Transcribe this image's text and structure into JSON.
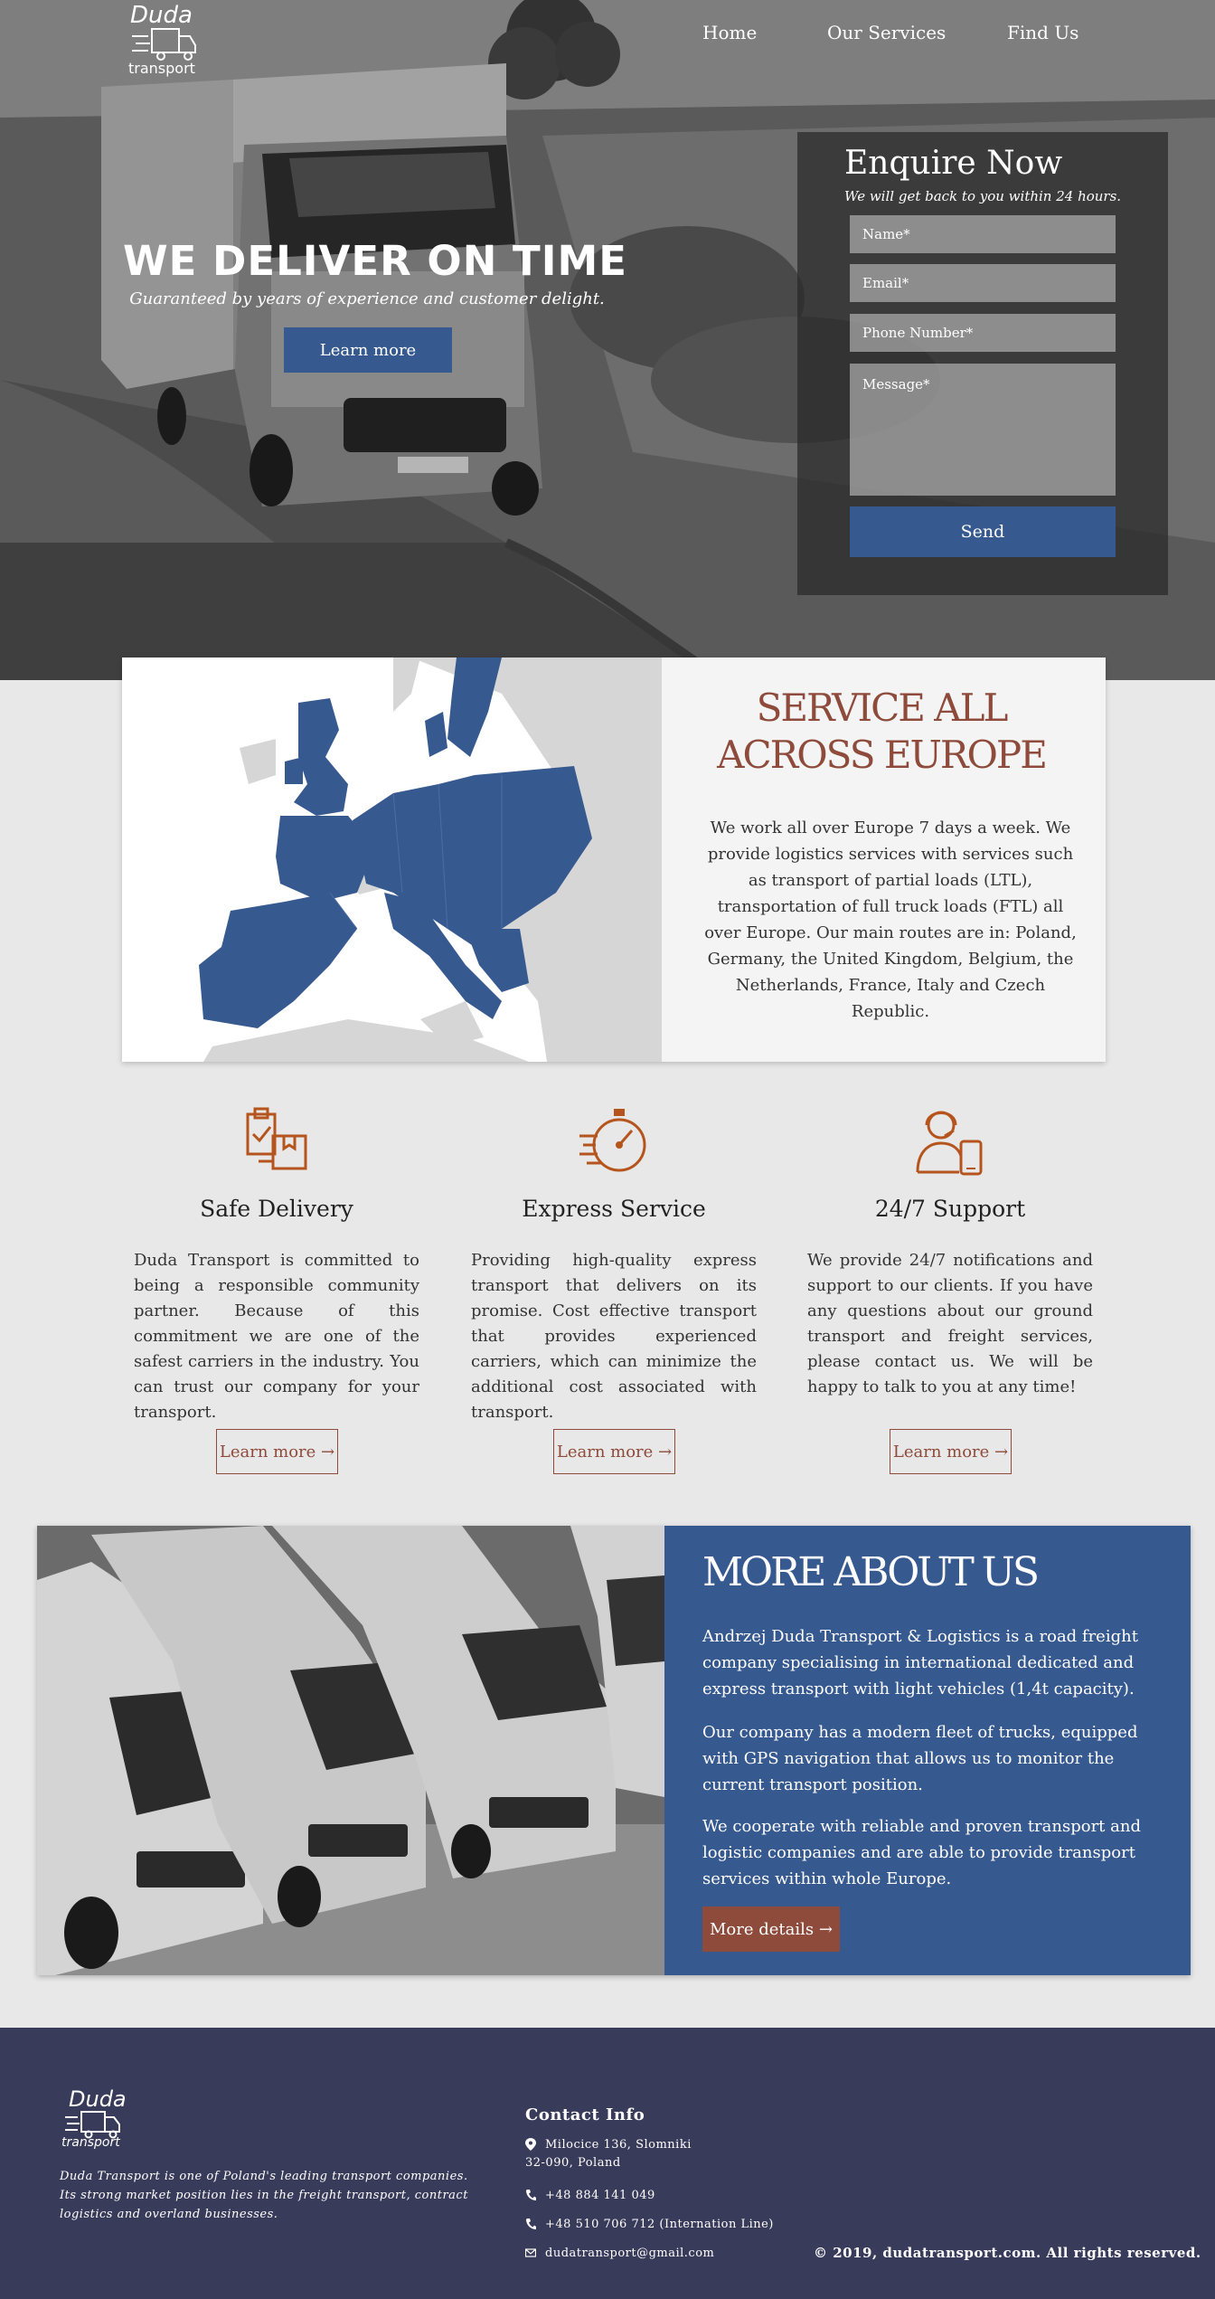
{
  "brand": {
    "name": "Duda",
    "sub": "transport"
  },
  "nav": {
    "items": [
      "Home",
      "Our Services",
      "Find Us"
    ]
  },
  "hero": {
    "title": "WE DELIVER ON TIME",
    "subtitle": "Guaranteed by years of experience and customer delight.",
    "cta": "Learn more"
  },
  "enquire": {
    "title": "Enquire Now",
    "subtitle": "We will get back to you within 24 hours.",
    "name_placeholder": "Name*",
    "email_placeholder": "Email*",
    "phone_placeholder": "Phone Number*",
    "message_placeholder": "Message*",
    "send": "Send"
  },
  "europe": {
    "title": "SERVICE ALL ACROSS EUROPE",
    "body": "We work all over Europe 7 days a week. We provide logistics services with services such as transport of partial loads (LTL), transportation of full truck loads (FTL) all over Europe. Our main routes are in: Poland, Germany, the United Kingdom, Belgium, the Netherlands, France, Italy and Czech Republic."
  },
  "features": [
    {
      "icon": "clipboard-box-icon",
      "title": "Safe Delivery",
      "body": "Duda Transport is committed to being a responsible community partner. Because of this commitment we are one of the safest carriers in the industry. You can trust our company for your transport.",
      "button": "Learn more →"
    },
    {
      "icon": "stopwatch-icon",
      "title": "Express Service",
      "body": "Providing high-quality express transport that delivers on its promise. Cost effective transport that provides experienced carriers, which can minimize the additional cost associated with transport.",
      "button": "Learn more →"
    },
    {
      "icon": "support-agent-icon",
      "title": "24/7 Support",
      "body": "We provide 24/7 notifications and support to our clients. If you have any questions about our ground transport and freight services, please contact us. We will be happy to talk to you at any time!",
      "button": "Learn more →"
    }
  ],
  "about": {
    "title": "MORE ABOUT US",
    "p1": "Andrzej Duda Transport & Logistics is a road freight company specialising in international dedicated and express transport with light vehicles (1,4t capacity).",
    "p2": "Our company has a modern fleet of trucks, equipped with GPS navigation that allows us to monitor the current transport position.",
    "p3": "We cooperate with reliable and proven transport and logistic companies and are able to provide transport services within whole Europe.",
    "button": "More details →"
  },
  "footer": {
    "description": "Duda Transport is one of Poland's leading transport companies. Its strong market position lies in the freight transport, contract logistics and overland businesses.",
    "contact_title": "Contact Info",
    "address_line1": "Milocice 136, Slomniki",
    "address_line2": "32-090, Poland",
    "phone1": "+48 884 141 049",
    "phone2": "+48 510 706 712 (Internation Line)",
    "email": "dudatransport@gmail.com",
    "copyright": "© 2019, dudatransport.com. All rights reserved."
  },
  "colors": {
    "primary_blue": "#365990",
    "accent_rust": "#8e4a3a",
    "footer_bg": "#393b5a",
    "icon_orange": "#b5541c"
  }
}
